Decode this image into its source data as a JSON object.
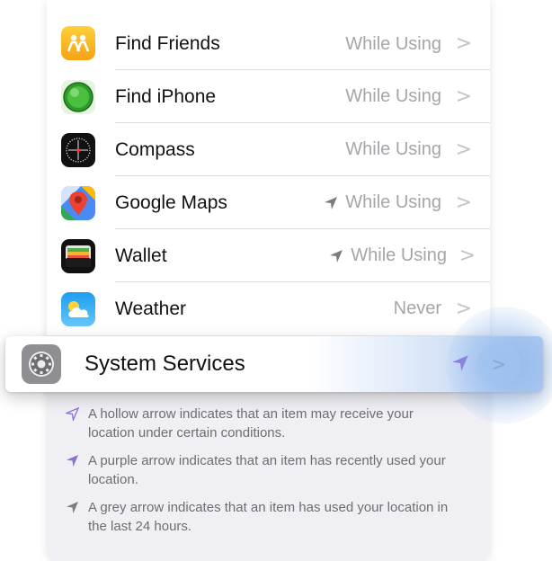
{
  "apps": [
    {
      "name": "Find Friends",
      "status": "While Using",
      "arrow": "none",
      "icon": "find-friends-icon"
    },
    {
      "name": "Find iPhone",
      "status": "While Using",
      "arrow": "none",
      "icon": "find-iphone-icon"
    },
    {
      "name": "Compass",
      "status": "While Using",
      "arrow": "none",
      "icon": "compass-icon"
    },
    {
      "name": "Google Maps",
      "status": "While Using",
      "arrow": "grey",
      "icon": "google-maps-icon"
    },
    {
      "name": "Wallet",
      "status": "While Using",
      "arrow": "grey",
      "icon": "wallet-icon"
    },
    {
      "name": "Weather",
      "status": "Never",
      "arrow": "none",
      "icon": "weather-icon"
    }
  ],
  "chevron": ">",
  "system_services": {
    "label": "System Services",
    "arrow": "purple"
  },
  "notes": [
    {
      "arrow": "hollow",
      "text": "A hollow arrow indicates that an item may receive your location under certain conditions."
    },
    {
      "arrow": "purple",
      "text": "A purple arrow indicates that an item has recently used your location."
    },
    {
      "arrow": "grey",
      "text": "A grey arrow indicates that an item has used your location in the last 24 hours."
    }
  ],
  "colors": {
    "purple_arrow": "#8e6fd8",
    "grey_arrow": "#8e8e93",
    "highlight": "#a8c6f0"
  }
}
